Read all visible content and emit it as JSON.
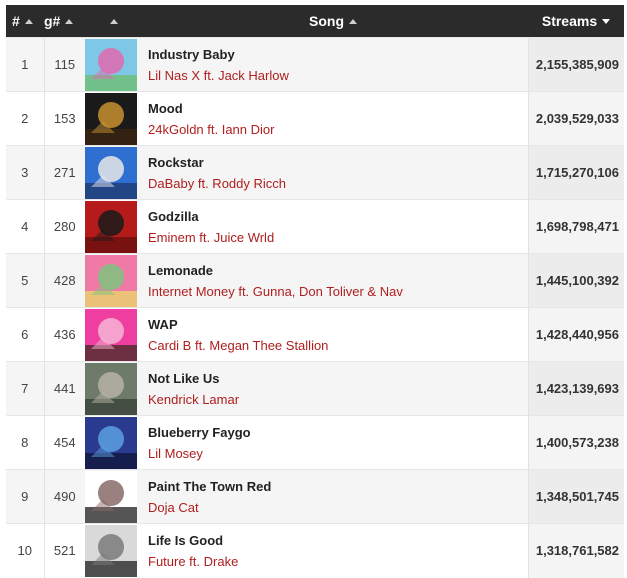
{
  "header": {
    "rank": "#",
    "gnum": "g#",
    "song": "Song",
    "streams": "Streams"
  },
  "rows": [
    {
      "rank": "1",
      "gnum": "115",
      "title": "Industry Baby",
      "artist": "Lil Nas X ft. Jack Harlow",
      "streams": "2,155,385,909",
      "art_colors": [
        "#7fc7e6",
        "#e06ab0",
        "#6fbf73"
      ]
    },
    {
      "rank": "2",
      "gnum": "153",
      "title": "Mood",
      "artist": "24kGoldn ft. Iann Dior",
      "streams": "2,039,529,033",
      "art_colors": [
        "#1a1a1a",
        "#c8912f",
        "#3a2410"
      ]
    },
    {
      "rank": "3",
      "gnum": "271",
      "title": "Rockstar",
      "artist": "DaBaby ft. Roddy Ricch",
      "streams": "1,715,270,106",
      "art_colors": [
        "#2e6fd1",
        "#e7e7e7",
        "#1f3b73"
      ]
    },
    {
      "rank": "4",
      "gnum": "280",
      "title": "Godzilla",
      "artist": "Eminem ft. Juice Wrld",
      "streams": "1,698,798,471",
      "art_colors": [
        "#b51b1b",
        "#1a1a1a",
        "#6a0f0f"
      ]
    },
    {
      "rank": "5",
      "gnum": "428",
      "title": "Lemonade",
      "artist": "Internet Money ft. Gunna, Don Toliver & Nav",
      "streams": "1,445,100,392",
      "art_colors": [
        "#f07aa6",
        "#7dc47e",
        "#e9d36a"
      ]
    },
    {
      "rank": "6",
      "gnum": "436",
      "title": "WAP",
      "artist": "Cardi B ft. Megan Thee Stallion",
      "streams": "1,428,440,956",
      "art_colors": [
        "#ee3fa0",
        "#f6b5d6",
        "#4b2c2a"
      ]
    },
    {
      "rank": "7",
      "gnum": "441",
      "title": "Not Like Us",
      "artist": "Kendrick Lamar",
      "streams": "1,423,139,693",
      "art_colors": [
        "#6e7a6a",
        "#b7b2a6",
        "#3b4438"
      ]
    },
    {
      "rank": "8",
      "gnum": "454",
      "title": "Blueberry Faygo",
      "artist": "Lil Mosey",
      "streams": "1,400,573,238",
      "art_colors": [
        "#2a3a8f",
        "#5aa0e0",
        "#12183d"
      ]
    },
    {
      "rank": "9",
      "gnum": "490",
      "title": "Paint The Town Red",
      "artist": "Doja Cat",
      "streams": "1,348,501,745",
      "art_colors": [
        "#ffffff",
        "#8a6a6a",
        "#2b2b2b"
      ]
    },
    {
      "rank": "10",
      "gnum": "521",
      "title": "Life Is Good",
      "artist": "Future ft. Drake",
      "streams": "1,318,761,582",
      "art_colors": [
        "#d9d9d9",
        "#7a7a7a",
        "#2a2a2a"
      ]
    }
  ]
}
